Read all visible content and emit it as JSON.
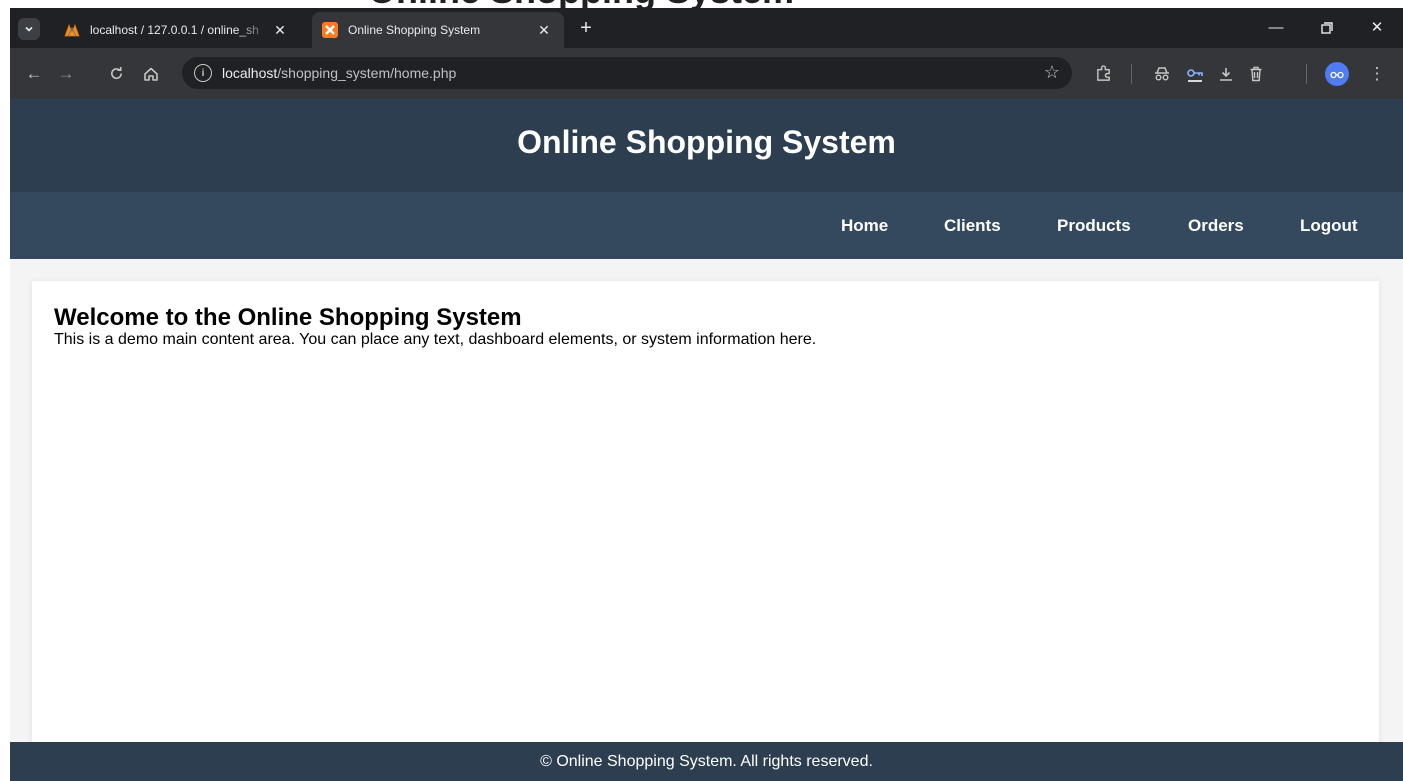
{
  "tabs": [
    {
      "title": "localhost / 127.0.0.1 / online_sh",
      "favicon": "phpmyadmin-icon",
      "active": false
    },
    {
      "title": "Online Shopping System",
      "favicon": "xampp-icon",
      "active": true
    }
  ],
  "address_bar": {
    "url_host": "localhost",
    "url_path": "/shopping_system/home.php"
  },
  "site": {
    "title": "Online Shopping System",
    "nav": [
      "Home",
      "Clients",
      "Products",
      "Orders",
      "Logout"
    ],
    "welcome_heading": "Welcome to the Online Shopping System",
    "welcome_text": "This is a demo main content area. You can place any text, dashboard elements, or system information here.",
    "footer": "© Online Shopping System. All rights reserved."
  },
  "colors": {
    "header": "#2c3e50",
    "nav": "#34495e",
    "page_bg": "#f4f4f4",
    "browser_frame": "#202124"
  }
}
